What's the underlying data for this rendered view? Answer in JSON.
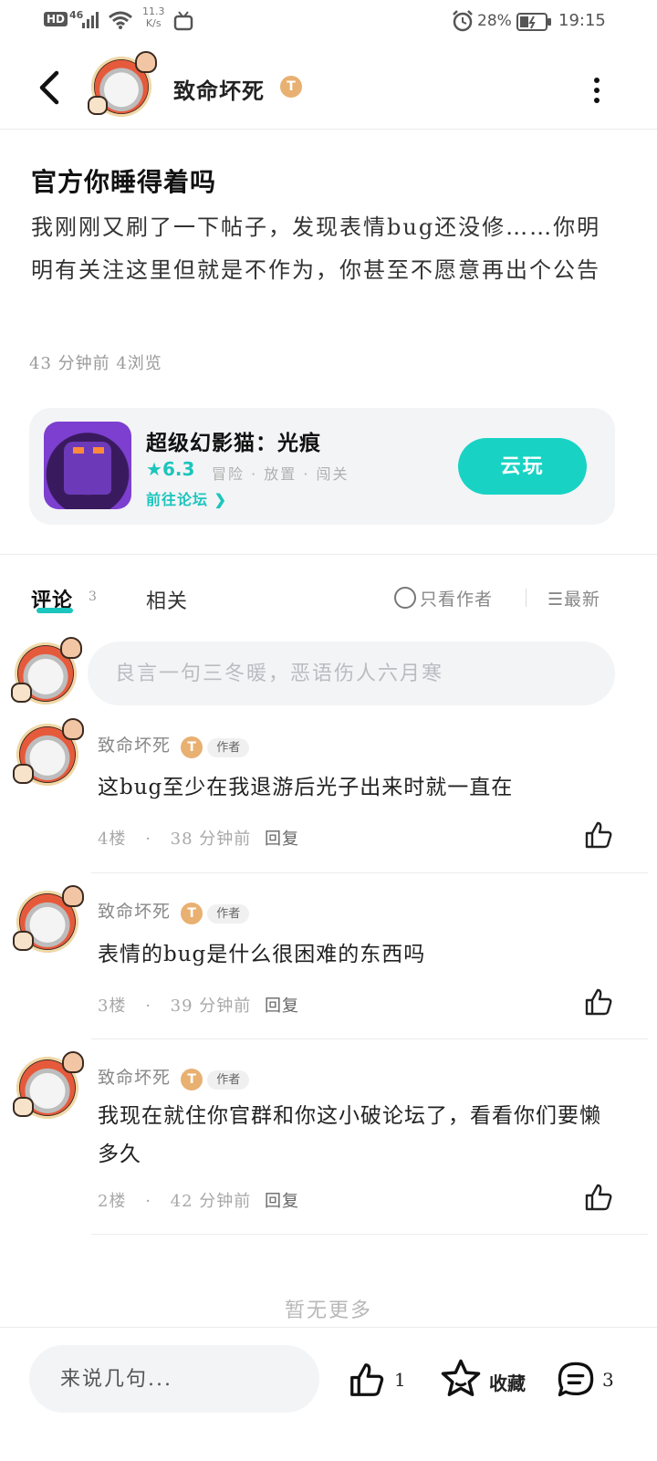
{
  "status_bar": {
    "hd": "HD",
    "network": "46",
    "speed_value": "11.3",
    "speed_unit": "K/s",
    "battery": "28%",
    "time": "19:15"
  },
  "header": {
    "username": "致命坏死",
    "badge": "T",
    "icons": [
      "back-arrow",
      "avatar",
      "more-vertical"
    ]
  },
  "post": {
    "title": "官方你睡得着吗",
    "body": "我刚刚又刷了一下帖子，发现表情bug还没修……你明明有关注这里但就是不作为，你甚至不愿意再出个公告",
    "meta": "43 分钟前  4浏览"
  },
  "game_card": {
    "name": "超级幻影猫：光痕",
    "rating": "6.3",
    "tags": "冒险 · 放置 · 闯关",
    "link": "前往论坛",
    "cloud_play": "云玩",
    "accent": "#18d3c4"
  },
  "tabs": {
    "comments_label": "评论",
    "comments_count": "3",
    "related_label": "相关",
    "only_author": "只看作者",
    "sort": "最新"
  },
  "comment_input": {
    "placeholder": "良言一句三冬暖，恶语伤人六月寒"
  },
  "comments": [
    {
      "name": "致命坏死",
      "badge": "T",
      "tag": "作者",
      "text": "这bug至少在我退游后光子出来时就一直在",
      "floor": "4楼",
      "time": "38 分钟前",
      "reply": "回复"
    },
    {
      "name": "致命坏死",
      "badge": "T",
      "tag": "作者",
      "text": "表情的bug是什么很困难的东西吗",
      "floor": "3楼",
      "time": "39 分钟前",
      "reply": "回复"
    },
    {
      "name": "致命坏死",
      "badge": "T",
      "tag": "作者",
      "text": "我现在就住你官群和你这小破论坛了，看看你们要懒多久",
      "floor": "2楼",
      "time": "42 分钟前",
      "reply": "回复"
    }
  ],
  "no_more": "暂无更多",
  "bottom_bar": {
    "placeholder": "来说几句...",
    "like_count": "1",
    "favorite_label": "收藏",
    "comment_count": "3"
  }
}
